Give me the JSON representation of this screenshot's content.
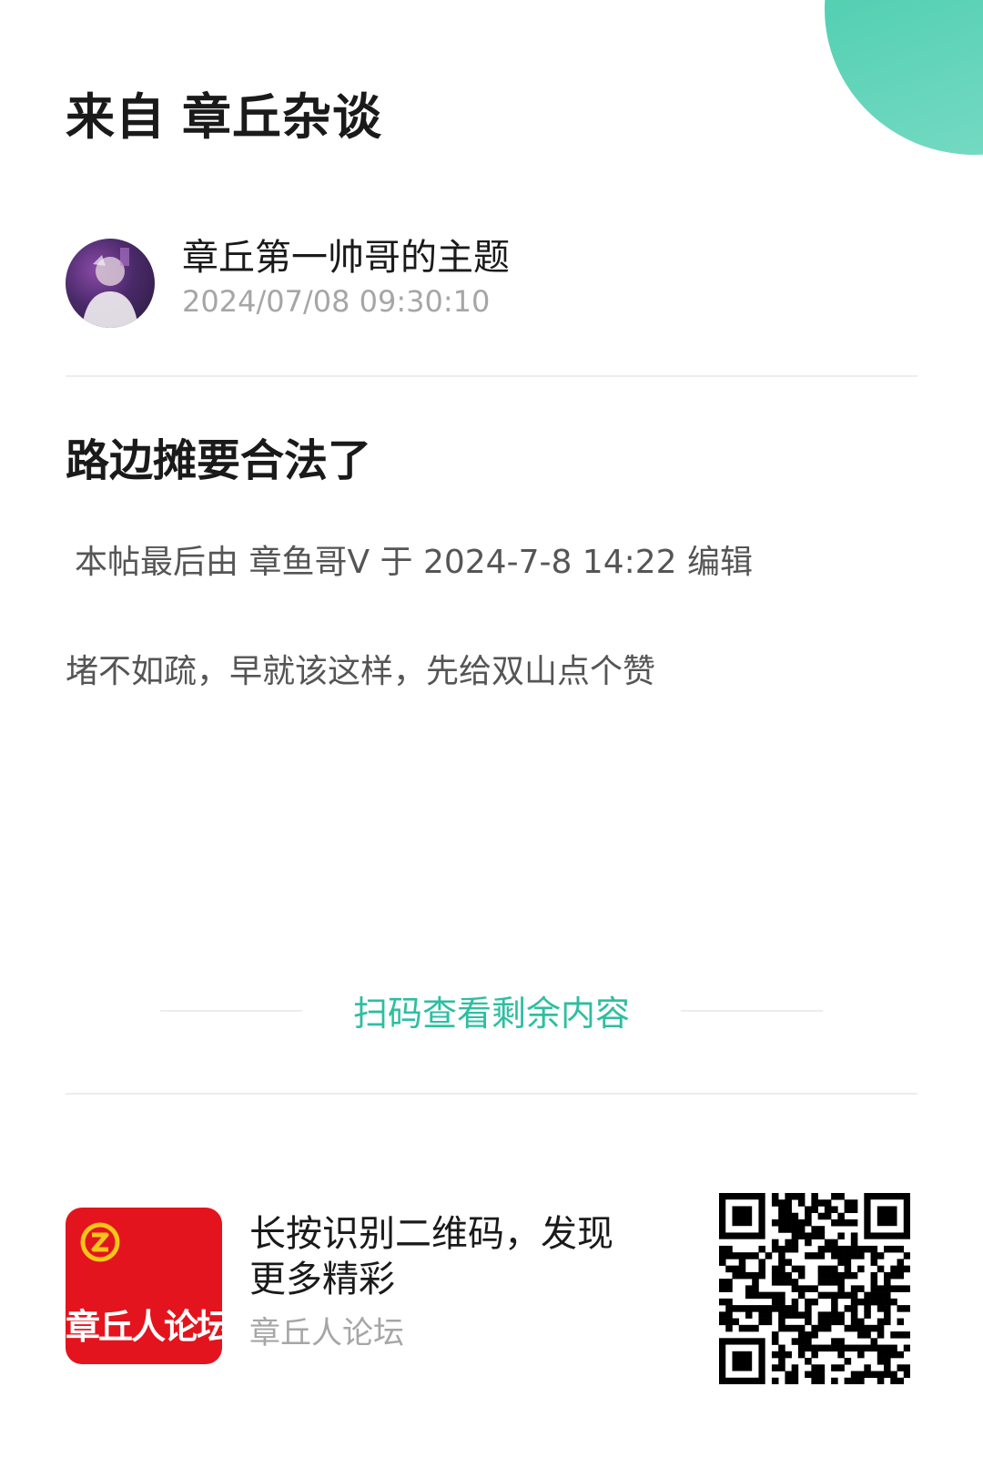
{
  "header": {
    "source_prefix": "来自",
    "forum_section": "章丘杂谈"
  },
  "author": {
    "name": "章丘第一帅哥的主题",
    "timestamp": "2024/07/08 09:30:10"
  },
  "post": {
    "title": "路边摊要合法了",
    "edit_note": "本帖最后由 章鱼哥V 于 2024-7-8 14:22 编辑",
    "body": "堵不如疏，早就该这样，先给双山点个赞"
  },
  "scan_more": {
    "label": "扫码查看剩余内容"
  },
  "footer": {
    "cta": "长按识别二维码，发现更多精彩",
    "forum_name": "章丘人论坛",
    "logo_text": "章丘人论坛"
  },
  "icons": {
    "avatar": "user-avatar-image",
    "logo_mark": "forum-logo-emblem",
    "qr": "qr-code"
  },
  "colors": {
    "accent": "#2ebea0",
    "corner": "#3ec9a8",
    "logo_bg": "#e3141d",
    "muted": "#a6a6a6"
  }
}
